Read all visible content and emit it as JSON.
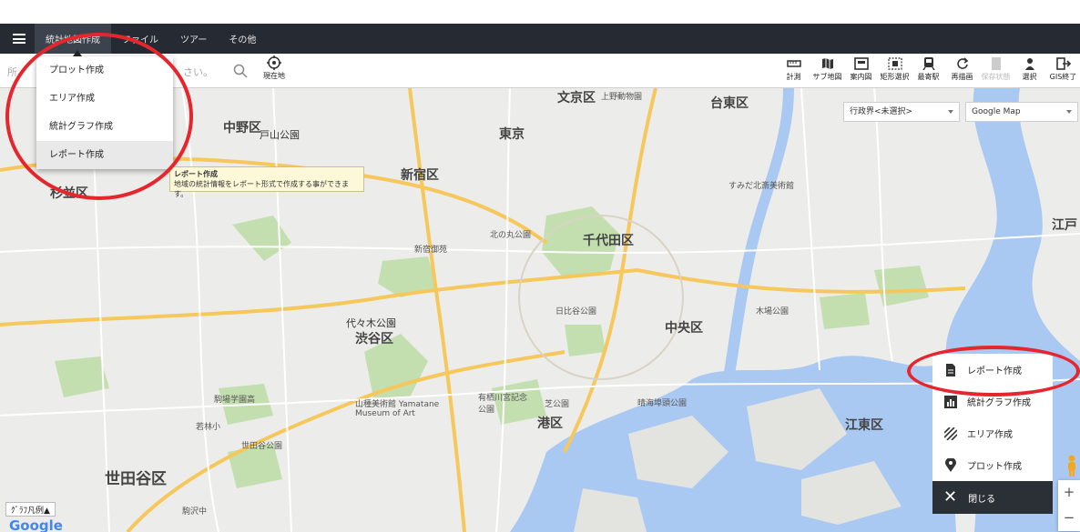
{
  "menubar": {
    "items": [
      "統計地図作成",
      "ファイル",
      "ツアー",
      "その他"
    ]
  },
  "search": {
    "text_left": "所、",
    "text_right": "さい。"
  },
  "here_label": "現在地",
  "tools": [
    {
      "label": "計測",
      "icon": "ruler-icon",
      "disabled": false
    },
    {
      "label": "サブ地図",
      "icon": "map-icon",
      "disabled": false
    },
    {
      "label": "案内図",
      "icon": "guide-map-icon",
      "disabled": false
    },
    {
      "label": "矩形選択",
      "icon": "rect-select-icon",
      "disabled": false
    },
    {
      "label": "最寄駅",
      "icon": "train-icon",
      "disabled": false
    },
    {
      "label": "再描画",
      "icon": "refresh-icon",
      "disabled": false
    },
    {
      "label": "保存状態",
      "icon": "save-icon",
      "disabled": true
    },
    {
      "label": "選択",
      "icon": "select-icon",
      "disabled": false
    },
    {
      "label": "GIS終了",
      "icon": "exit-icon",
      "disabled": false
    }
  ],
  "dropdown": {
    "items": [
      "プロット作成",
      "エリア作成",
      "統計グラフ作成",
      "レポート作成"
    ]
  },
  "tooltip": {
    "title": "レポート作成",
    "body": "地域の統計情報をレポート形式で作成する事ができます。"
  },
  "selects": {
    "boundary": "行政界<未選択>",
    "maptype": "Google Map"
  },
  "fab_menu": {
    "items": [
      {
        "label": "レポート作成",
        "icon": "document-icon"
      },
      {
        "label": "統計グラフ作成",
        "icon": "bar-chart-icon"
      },
      {
        "label": "エリア作成",
        "icon": "hatch-icon"
      },
      {
        "label": "プロット作成",
        "icon": "pin-icon"
      }
    ],
    "close_label": "閉じる"
  },
  "legend_label": "ｸﾞﾗﾌ凡例▲",
  "google_logo": "Google",
  "map_labels": {
    "nakano": "中野区",
    "suginami": "杉並区",
    "shinjuku": "新宿区",
    "chiyoda": "千代田区",
    "bunkyo": "文京区",
    "taito": "台東区",
    "tokyo": "東京",
    "chuo": "中央区",
    "minato": "港区",
    "shibuya": "渋谷区",
    "setagaya": "世田谷区",
    "koto": "江東区",
    "edo": "江戸",
    "toyama": "戸山公園",
    "yoyogi": "代々木公園",
    "museum": "山種美術館 Yamatane Museum of Art",
    "shinjuku_gyoen": "新宿御苑",
    "kitanomaru": "北の丸公園",
    "hibiya": "日比谷公園",
    "ueno": "上野動物園",
    "sumida": "すみだ北斎美術館",
    "kiba": "木場公園",
    "arisugawa": "有栖川宮記念公園",
    "shiba": "芝公園",
    "harumi": "晴海埠頭公園",
    "setagaya_park": "世田谷公園",
    "wakabayashi": "若林小",
    "komaba": "駒場学園高",
    "komazawa": "駒沢中"
  }
}
